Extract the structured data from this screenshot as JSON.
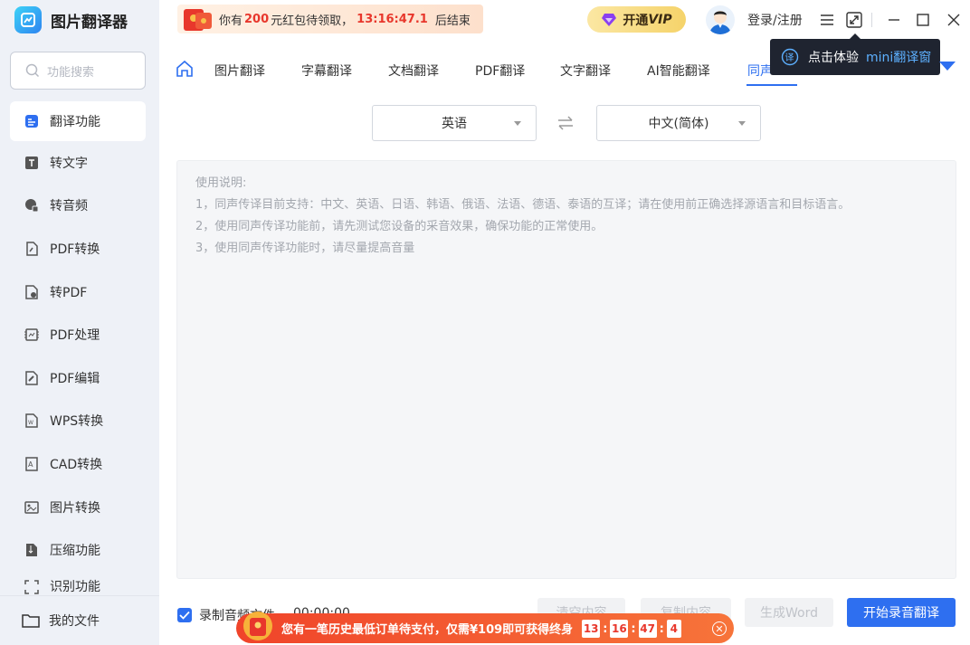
{
  "app": {
    "title": "图片翻译器"
  },
  "search": {
    "placeholder": "功能搜索"
  },
  "sidebar": {
    "items": [
      {
        "label": "翻译功能",
        "icon": "translate-icon"
      },
      {
        "label": "转文字",
        "icon": "text-icon"
      },
      {
        "label": "转音频",
        "icon": "audio-icon"
      },
      {
        "label": "PDF转换",
        "icon": "pdf-convert-icon"
      },
      {
        "label": "转PDF",
        "icon": "to-pdf-icon"
      },
      {
        "label": "PDF处理",
        "icon": "pdf-process-icon"
      },
      {
        "label": "PDF编辑",
        "icon": "pdf-edit-icon"
      },
      {
        "label": "WPS转换",
        "icon": "wps-icon"
      },
      {
        "label": "CAD转换",
        "icon": "cad-icon"
      },
      {
        "label": "图片转换",
        "icon": "image-icon"
      },
      {
        "label": "压缩功能",
        "icon": "compress-icon"
      },
      {
        "label": "识别功能",
        "icon": "recognize-icon"
      }
    ],
    "my_files": "我的文件"
  },
  "promo": {
    "prefix": "你有",
    "amount": "200",
    "suffix": " 元红包待领取，",
    "timer": "13:16:47.1",
    "end": "后结束"
  },
  "vip": {
    "prefix": "开通",
    "v": "VIP"
  },
  "login": "登录/注册",
  "tabs": [
    {
      "label": "图片翻译"
    },
    {
      "label": "字幕翻译"
    },
    {
      "label": "文档翻译"
    },
    {
      "label": "PDF翻译"
    },
    {
      "label": "文字翻译"
    },
    {
      "label": "AI智能翻译"
    },
    {
      "label": "同声"
    }
  ],
  "tooltip": {
    "text": "点击体验",
    "highlight": "mini翻译窗",
    "badge": "译"
  },
  "lang": {
    "source": "英语",
    "target": "中文(简体)"
  },
  "instructions": {
    "title": "使用说明:",
    "lines": [
      "1，同声传译目前支持：中文、英语、日语、韩语、俄语、法语、德语、泰语的互译；请在使用前正确选择源语言和目标语言。",
      "2，使用同声传译功能前，请先测试您设备的采音效果，确保功能的正常使用。",
      "3，使用同声传译功能时，请尽量提高音量"
    ]
  },
  "recording": {
    "label": "录制音频文件",
    "time": "00:00:00",
    "checked": true
  },
  "buttons": {
    "clear": "清空内容",
    "copy": "复制内容",
    "word": "生成Word",
    "start": "开始录音翻译"
  },
  "banner": {
    "text": "您有一笔历史最低订单待支付，仅需¥109即可获得终身",
    "hh": "13",
    "mm": "16",
    "ss": "47",
    "ms": "4"
  },
  "colors": {
    "accent": "#2e6ff0",
    "promo_red": "#e8372c",
    "sidebar_bg": "#eef1f7"
  }
}
